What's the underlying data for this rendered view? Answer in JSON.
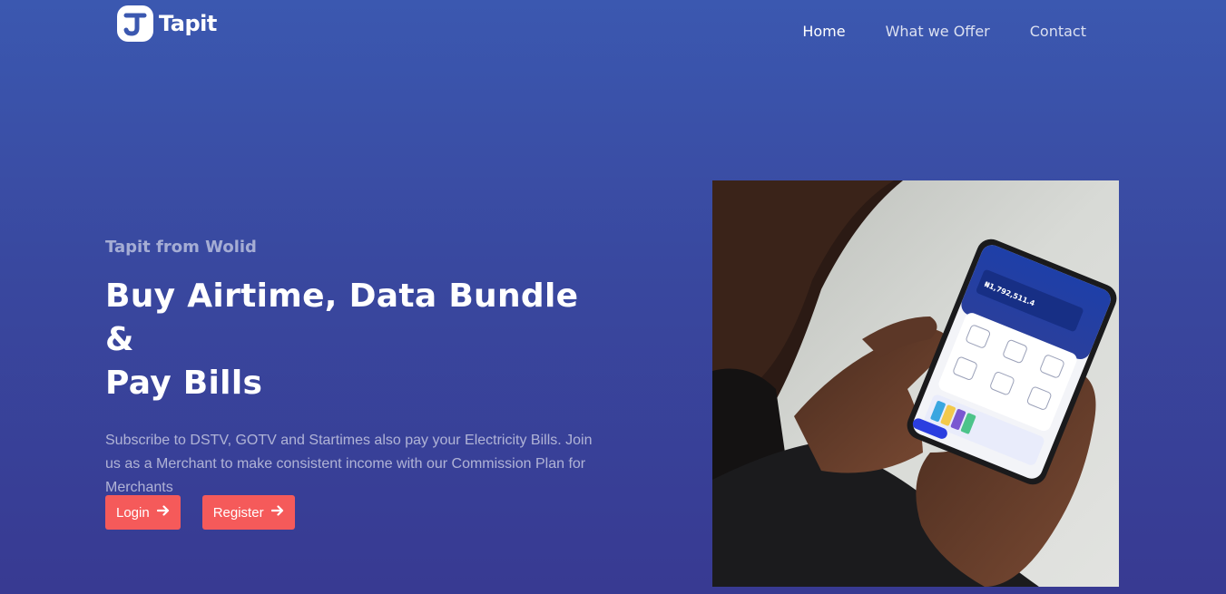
{
  "brand": {
    "name": "Tapit",
    "logo_icon": "tapit-logo-icon"
  },
  "nav": {
    "items": [
      {
        "label": "Home",
        "active": true
      },
      {
        "label": "What we Offer",
        "active": false
      },
      {
        "label": "Contact",
        "active": false
      }
    ]
  },
  "hero": {
    "eyebrow": "Tapit from Wolid",
    "headline_line1": "Buy Airtime, Data Bundle &",
    "headline_line2": "Pay Bills",
    "description": "Subscribe to DSTV, GOTV and Startimes also pay your Electricity Bills. Join us as a Merchant to make consistent income with our Commission Plan for Merchants",
    "buttons": [
      {
        "label": "Login",
        "icon": "arrow-right-icon"
      },
      {
        "label": "Register",
        "icon": "arrow-right-icon"
      }
    ]
  },
  "phone": {
    "balance": "₦1,792,511.4"
  },
  "colors": {
    "button": "#f55a5a",
    "background_top": "#3b58b0",
    "background_bottom": "#383a92"
  }
}
